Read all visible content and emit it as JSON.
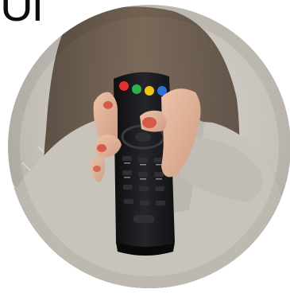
{
  "header": {
    "clipped_text": "Ul"
  },
  "photo": {
    "subject": "hand-holding-tv-remote",
    "colors": {
      "sweater": "#bdb8b0",
      "hair": "#5a4a3c",
      "skin": "#e0b39a",
      "nail": "#d45a4a",
      "remote": "#1c1c1e",
      "button_red": "#e0312a",
      "button_green": "#2bb24c",
      "button_yellow": "#f0c419",
      "button_blue": "#2a72d8"
    }
  }
}
